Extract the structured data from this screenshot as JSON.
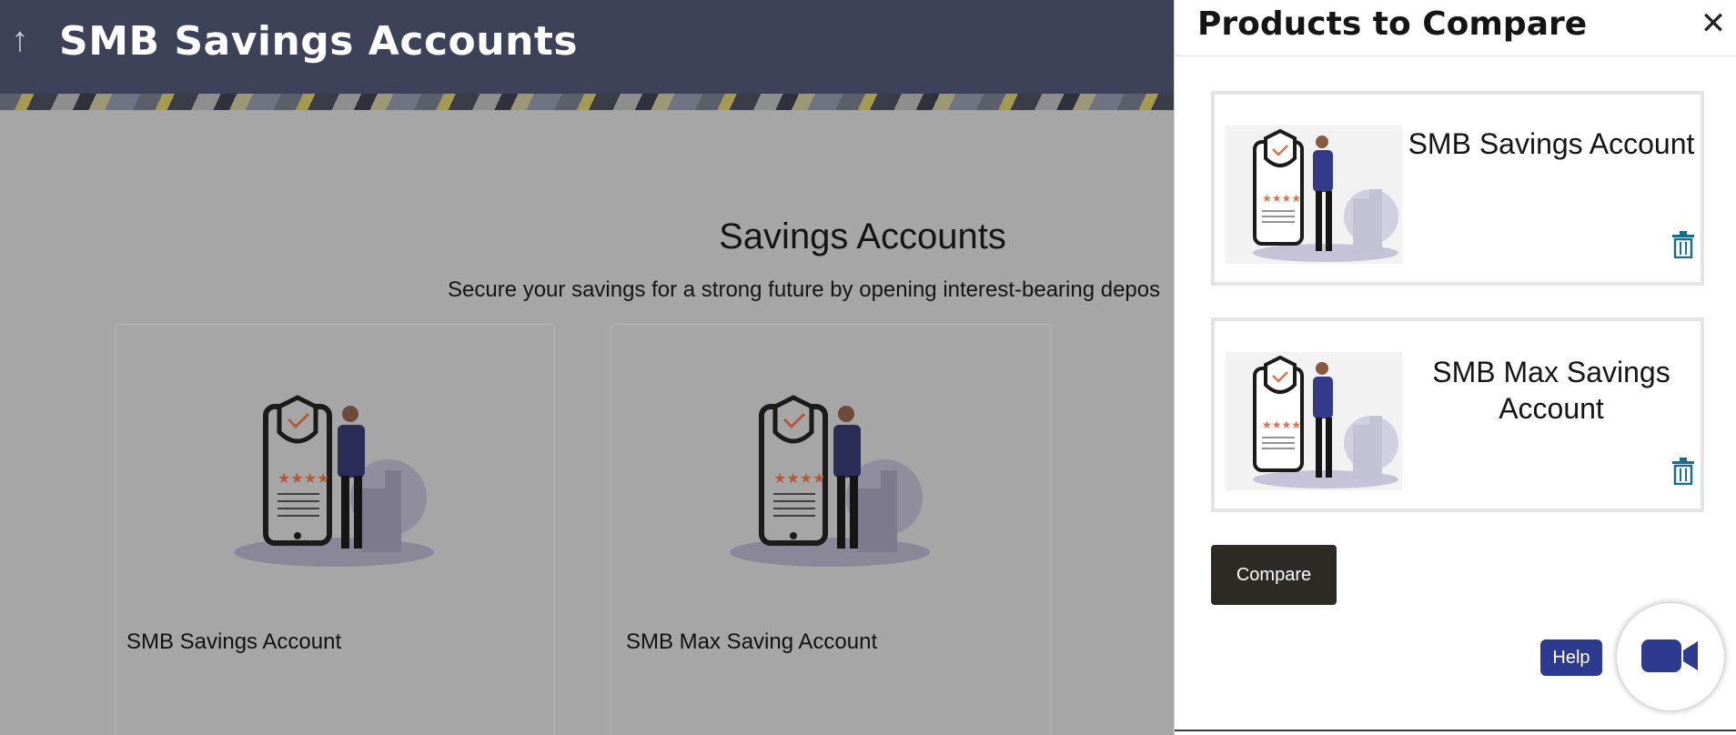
{
  "header": {
    "title": "SMB Savings Accounts",
    "back_icon": "arrow-up-icon"
  },
  "main": {
    "section_title": "Savings Accounts",
    "section_subtitle": "Secure your savings for a strong future by opening interest-bearing depos",
    "products": [
      {
        "name": "SMB Savings Account"
      },
      {
        "name": "SMB Max Saving Account"
      }
    ]
  },
  "panel": {
    "title": "Products to Compare",
    "close_icon": "close-icon",
    "items": [
      {
        "name": "SMB Savings Account"
      },
      {
        "name": "SMB Max Savings Account"
      }
    ],
    "compare_label": "Compare",
    "help_label": "Help",
    "video_icon": "video-camera-icon"
  },
  "colors": {
    "header_bg": "#3d4258",
    "overlay_bg": "#a6a6a6",
    "compare_btn": "#2e2a26",
    "help_btn": "#2c3a8f",
    "trash_icon": "#1a6e8c"
  }
}
